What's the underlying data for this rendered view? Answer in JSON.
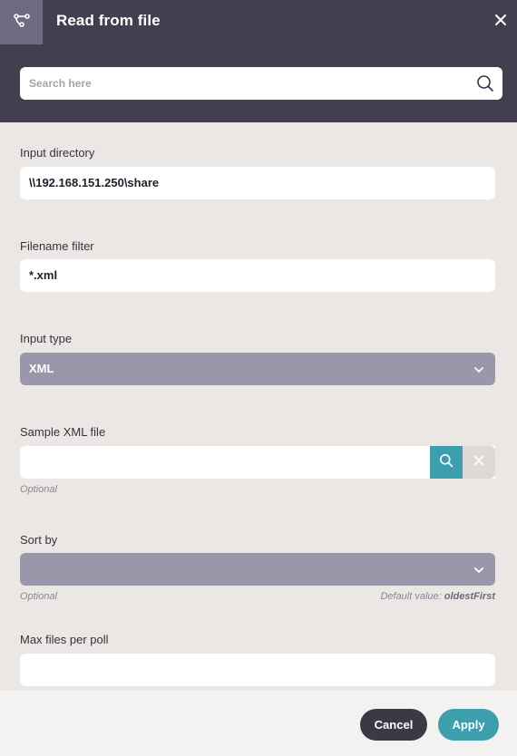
{
  "header": {
    "title": "Read from file",
    "icon": "flow-icon",
    "close_icon": "close-icon"
  },
  "search": {
    "placeholder": "Search here"
  },
  "fields": {
    "input_directory": {
      "label": "Input directory",
      "value": "\\\\192.168.151.250\\share"
    },
    "filename_filter": {
      "label": "Filename filter",
      "value": "*.xml"
    },
    "input_type": {
      "label": "Input type",
      "value": "XML"
    },
    "sample_xml_file": {
      "label": "Sample XML file",
      "value": "",
      "hint": "Optional"
    },
    "sort_by": {
      "label": "Sort by",
      "value": "",
      "hint": "Optional",
      "default_label": "Default value:",
      "default_value": "oldestFirst"
    },
    "max_files_per_poll": {
      "label": "Max files per poll",
      "value": ""
    }
  },
  "footer": {
    "cancel_label": "Cancel",
    "apply_label": "Apply"
  },
  "colors": {
    "header_bg": "#433f50",
    "accent": "#3d9fae",
    "select_bg": "#9a97ab",
    "page_bg": "#ebe7e4"
  }
}
